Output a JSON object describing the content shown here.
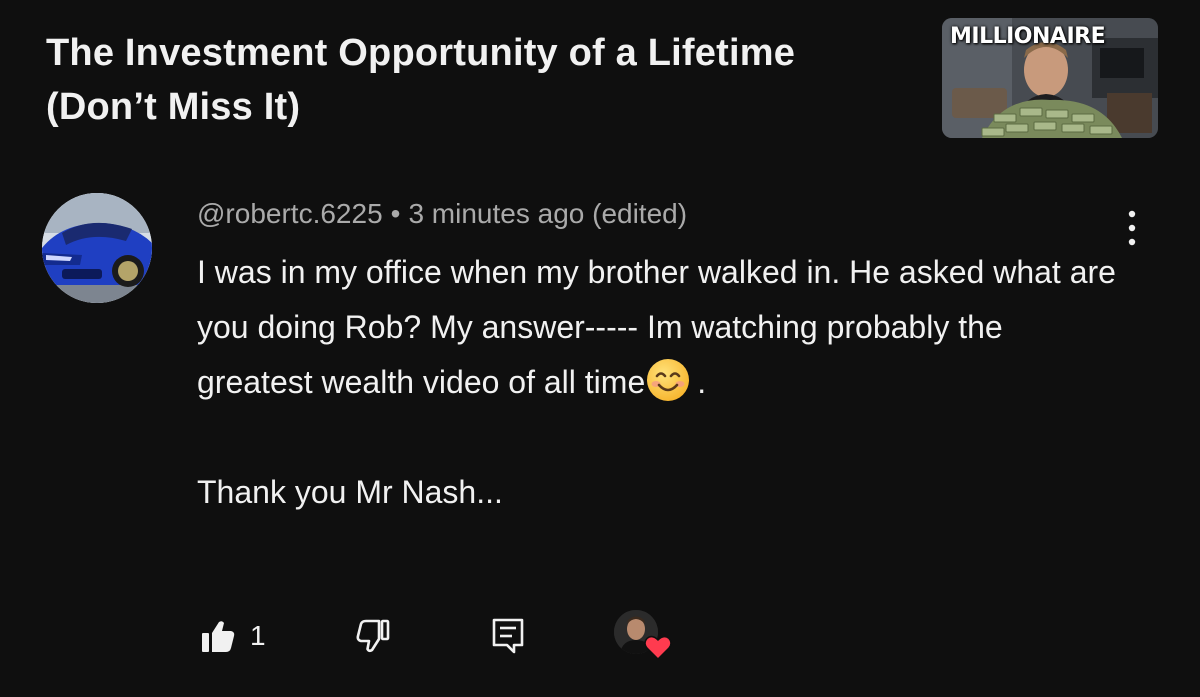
{
  "video": {
    "title": "The Investment Opportunity of a Lifetime\n(Don’t Miss It)",
    "thumbnail_text": "MILLIONAIRE",
    "thumbnail_icon": "video-thumbnail"
  },
  "comment": {
    "author": "@robertc.6225",
    "separator": "•",
    "time": "3 minutes ago (edited)",
    "body_part1": "I was in my office when my brother walked in. He asked what are you doing Rob? My answer----- Im watching probably the greatest wealth video of all time",
    "emoji": "smiling-face-emoji",
    "body_part2": ".\n\nThank you Mr Nash...",
    "more_icon": "more-vertical-icon"
  },
  "actions": {
    "like_icon": "thumbs-up-icon",
    "like_count": "1",
    "dislike_icon": "thumbs-down-icon",
    "reply_icon": "reply-comment-icon",
    "creator_heart_icon": "creator-heart-icon"
  },
  "colors": {
    "background": "#0f0f0f",
    "text": "#f1f1f1",
    "secondary_text": "#aaaaaa",
    "heart": "#ff3b4f"
  }
}
